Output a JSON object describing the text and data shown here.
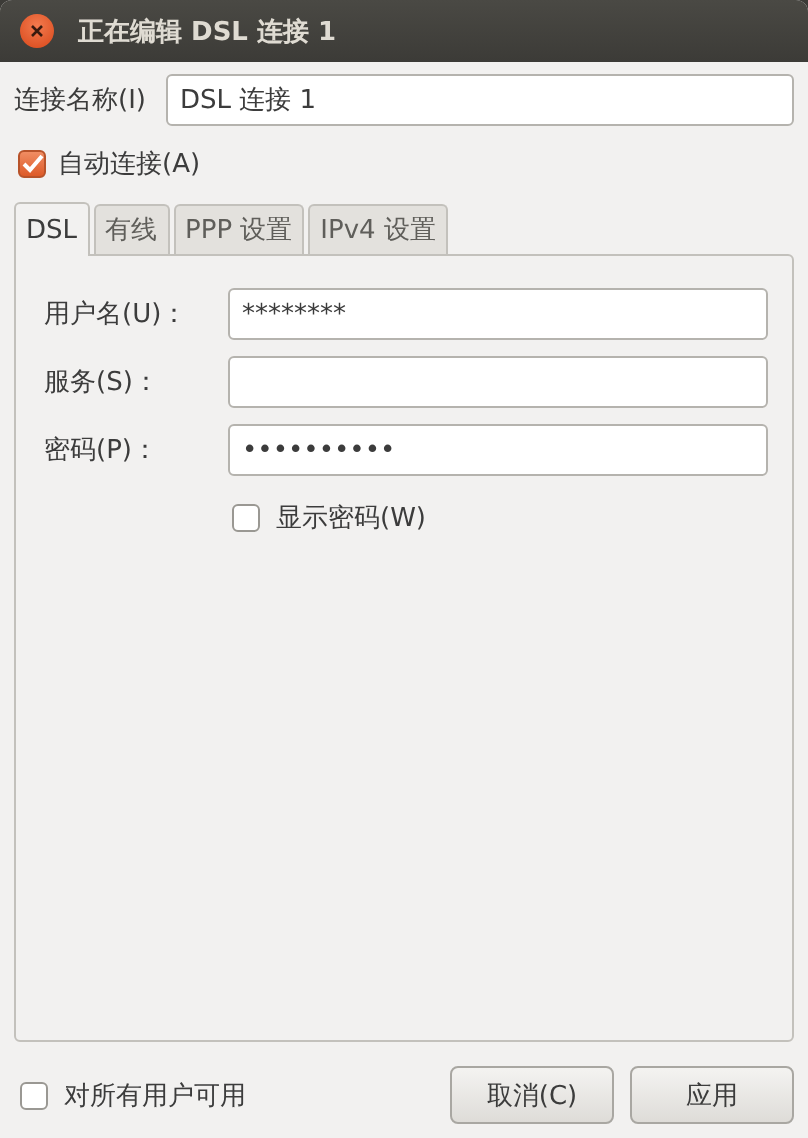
{
  "window": {
    "title": "正在编辑 DSL 连接 1"
  },
  "connection_name": {
    "label": "连接名称(I)",
    "value": "DSL 连接 1"
  },
  "auto_connect": {
    "label": "自动连接(A)",
    "checked": true
  },
  "tabs": [
    {
      "label": "DSL",
      "selected": true
    },
    {
      "label": "有线",
      "selected": false
    },
    {
      "label": "PPP 设置",
      "selected": false
    },
    {
      "label": "IPv4 设置",
      "selected": false
    }
  ],
  "fields": [
    {
      "label": "用户名(U)：",
      "value": "********"
    },
    {
      "label": "服务(S)："
    },
    {
      "label": "密码(P)：",
      "value": "••••••••••"
    }
  ],
  "show_password": {
    "label": "显示密码(W)",
    "checked": false
  },
  "all_users": {
    "label": "对所有用户可用",
    "checked": false
  },
  "buttons": [
    "取消(C)",
    "应用"
  ]
}
